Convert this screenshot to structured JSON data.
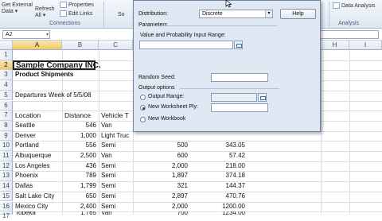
{
  "ribbon": {
    "get_external": "Get External",
    "get_external2": "Data ▾",
    "refresh": "Refresh",
    "refresh2": "All ▾",
    "properties": "Properties",
    "edit_links": "Edit Links",
    "connections_label": "Connections",
    "sort_label": "So",
    "data_analysis": "Data Analysis",
    "analysis_label": "Analysis"
  },
  "name_box": "A2",
  "columns": [
    "A",
    "B",
    "C",
    "H",
    "I"
  ],
  "rows": [
    "1",
    "2",
    "3",
    "4",
    "5",
    "6",
    "7",
    "8",
    "9",
    "10",
    "11",
    "12",
    "13",
    "14",
    "15",
    "16",
    "17"
  ],
  "sheet": {
    "title": "Sample Company INC.",
    "subtitle": "Product Shipments",
    "week_label": "Departures  Week of 5/5/08",
    "headers": [
      "Location",
      "Distance",
      "Vehicle T"
    ],
    "data": [
      {
        "loc": "Seattle",
        "dist": "546",
        "veh": "Van",
        "d": "",
        "e": ""
      },
      {
        "loc": "Denver",
        "dist": "1,000",
        "veh": "Light Truc",
        "d": "",
        "e": ""
      },
      {
        "loc": "Portland",
        "dist": "556",
        "veh": "Semi",
        "d": "500",
        "e": "343.05"
      },
      {
        "loc": "Albuquerque",
        "dist": "2,500",
        "veh": "Van",
        "d": "600",
        "e": "57.42"
      },
      {
        "loc": "Los Angeles",
        "dist": "436",
        "veh": "Semi",
        "d": "2,000",
        "e": "218.00"
      },
      {
        "loc": "Phoenix",
        "dist": "789",
        "veh": "Semi",
        "d": "1,897",
        "e": "374.18"
      },
      {
        "loc": "Dallas",
        "dist": "1,799",
        "veh": "Semi",
        "d": "321",
        "e": "144.37"
      },
      {
        "loc": "Salt Lake City",
        "dist": "650",
        "veh": "Semi",
        "d": "2,897",
        "e": "470.76"
      },
      {
        "loc": "Mexico City",
        "dist": "2,400",
        "veh": "Semi",
        "d": "2,000",
        "e": "1200.00"
      },
      {
        "loc": "Topeka",
        "dist": "1,765",
        "veh": "Van",
        "d": "700",
        "e": "1234.00"
      }
    ]
  },
  "dialog": {
    "distribution_label": "Distribution:",
    "distribution_value": "Discrete",
    "help": "Help",
    "parameters": "Parameters",
    "range_label": "Value and Probability Input Range:",
    "random_seed": "Random Seed:",
    "output_options": "Output options",
    "output_range": "Output Range:",
    "new_ply": "New Worksheet Ply:",
    "new_workbook": "New Workbook"
  }
}
